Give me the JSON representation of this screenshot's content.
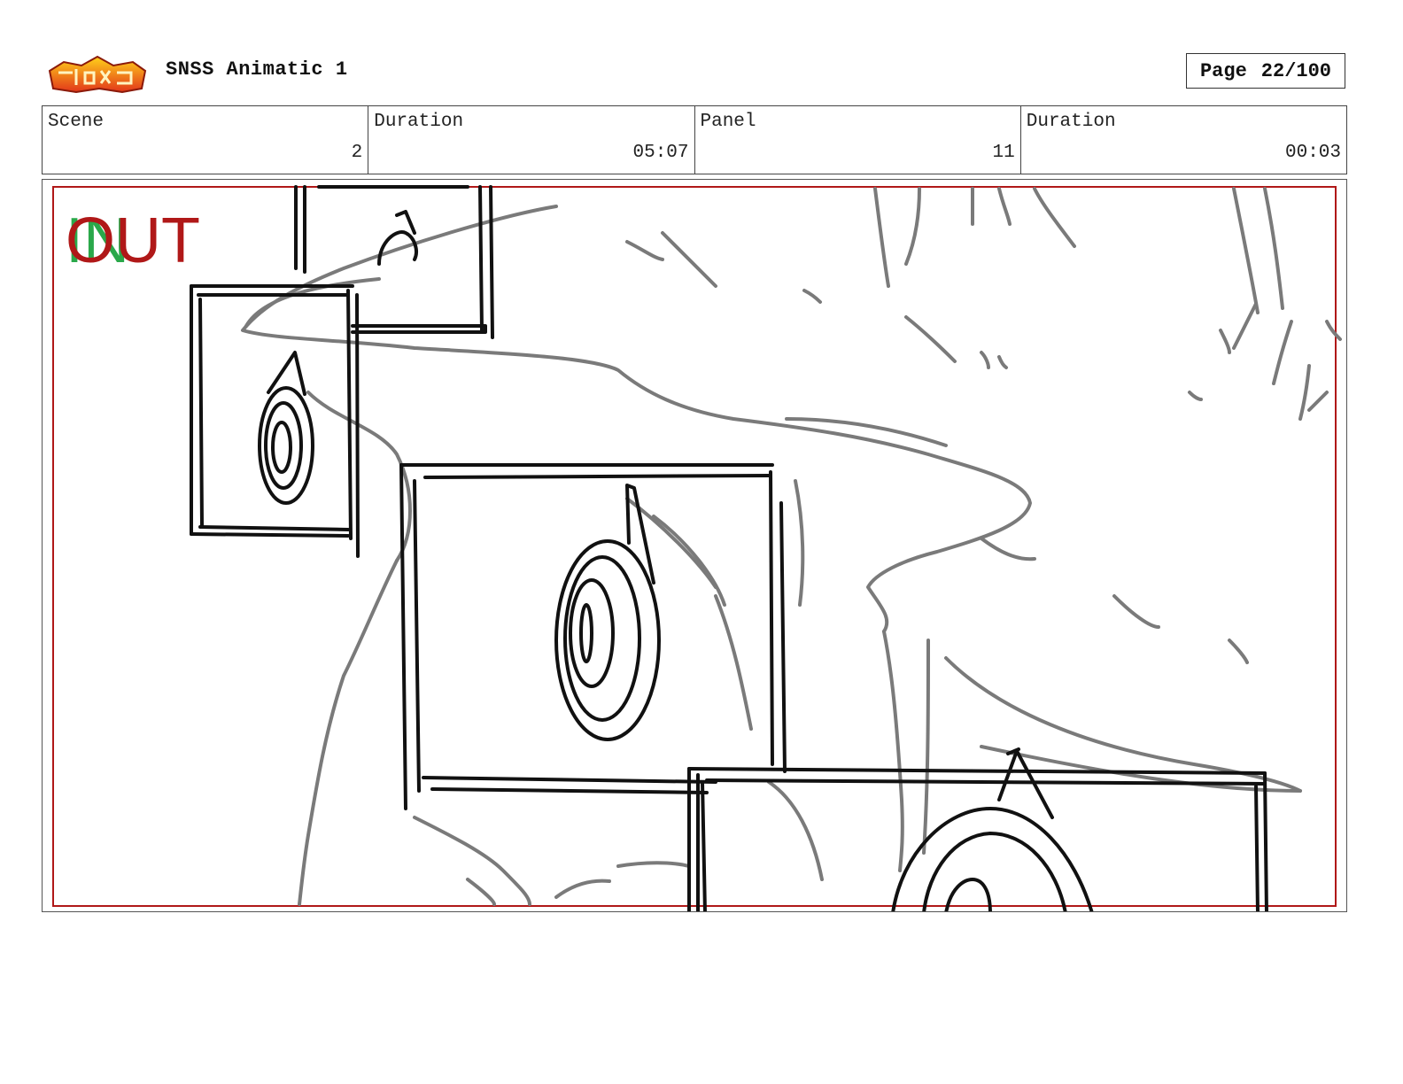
{
  "header": {
    "title": "SNSS Animatic 1",
    "page_label": "Page",
    "page_value": "22/100"
  },
  "info": {
    "scene_label": "Scene",
    "scene_value": "2",
    "scene_duration_label": "Duration",
    "scene_duration_value": "05:07",
    "panel_label": "Panel",
    "panel_value": "11",
    "panel_duration_label": "Duration",
    "panel_duration_value": "00:03"
  },
  "panel": {
    "in_marker": "IN",
    "out_marker": "OUT"
  },
  "colors": {
    "frame_border": "#b01818",
    "in_marker": "#2aa84a",
    "out_marker": "#b01818",
    "sketch_gray": "#7a7a7a",
    "sketch_black": "#111111"
  }
}
